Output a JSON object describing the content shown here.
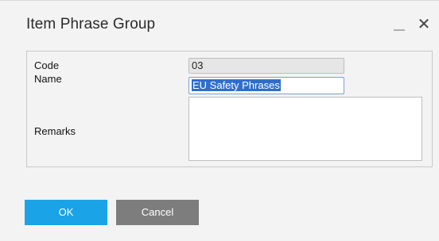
{
  "window": {
    "title": "Item Phrase Group",
    "close_glyph": "✕"
  },
  "form": {
    "code_label": "Code",
    "code_value": "03",
    "name_label": "Name",
    "name_value": "EU Safety Phrases",
    "remarks_label": "Remarks",
    "remarks_value": ""
  },
  "buttons": {
    "ok_label": "OK",
    "cancel_label": "Cancel"
  },
  "colors": {
    "ok_button": "#1aa3e6",
    "cancel_button": "#7d7d7d",
    "selection": "#2f6fcb"
  },
  "icons": {
    "minimize": "minimize-icon",
    "close": "close-icon"
  }
}
